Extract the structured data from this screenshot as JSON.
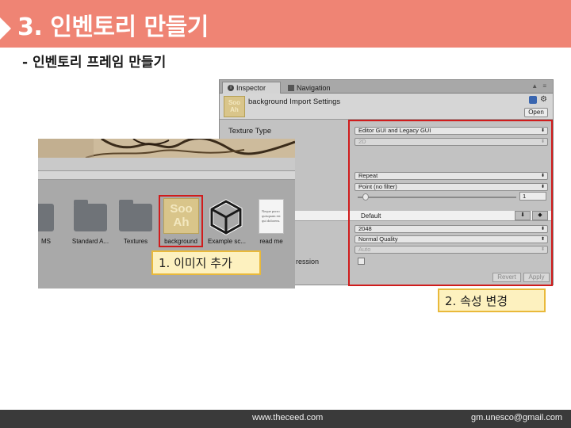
{
  "slide": {
    "title": "3. 인벤토리 만들기",
    "subtitle": "- 인벤토리 프레임 만들기",
    "footer_website": "www.theceed.com",
    "footer_email": "gm.unesco@gmail.com",
    "accent_color": "#ef8474"
  },
  "inspector": {
    "tabs": [
      {
        "label": "Inspector",
        "icon": "info-icon"
      },
      {
        "label": "Navigation",
        "icon": "navigation-icon"
      }
    ],
    "header_title": "background Import Settings",
    "thumb_text_line1": "Soo",
    "thumb_text_line2": "Ah",
    "open_label": "Open",
    "texture_type_label": "Texture Type",
    "texture_type_value": "Editor GUI and Legacy GUI",
    "shape_value": "2D",
    "wrap_mode_value": "Repeat",
    "filter_mode_value": "Point (no filter)",
    "aniso_value": "1",
    "platform_default_label": "Default",
    "max_size_value": "2048",
    "quality_value": "Normal Quality",
    "format_value": "Auto",
    "compression_label_partial": "ression",
    "revert_label": "Revert",
    "apply_label": "Apply"
  },
  "project": {
    "assets": [
      {
        "label": "MS"
      },
      {
        "label": "Standard A..."
      },
      {
        "label": "Textures"
      },
      {
        "label": "background"
      },
      {
        "label": "Example sc..."
      },
      {
        "label": "read me"
      }
    ],
    "bg_thumb_line1": "Soo",
    "bg_thumb_line2": "Ah",
    "readme_preview": "Neque porro quisquam est qui dolorem."
  },
  "callouts": {
    "step1": "1. 이미지 추가",
    "step2": "2. 속성 변경"
  }
}
